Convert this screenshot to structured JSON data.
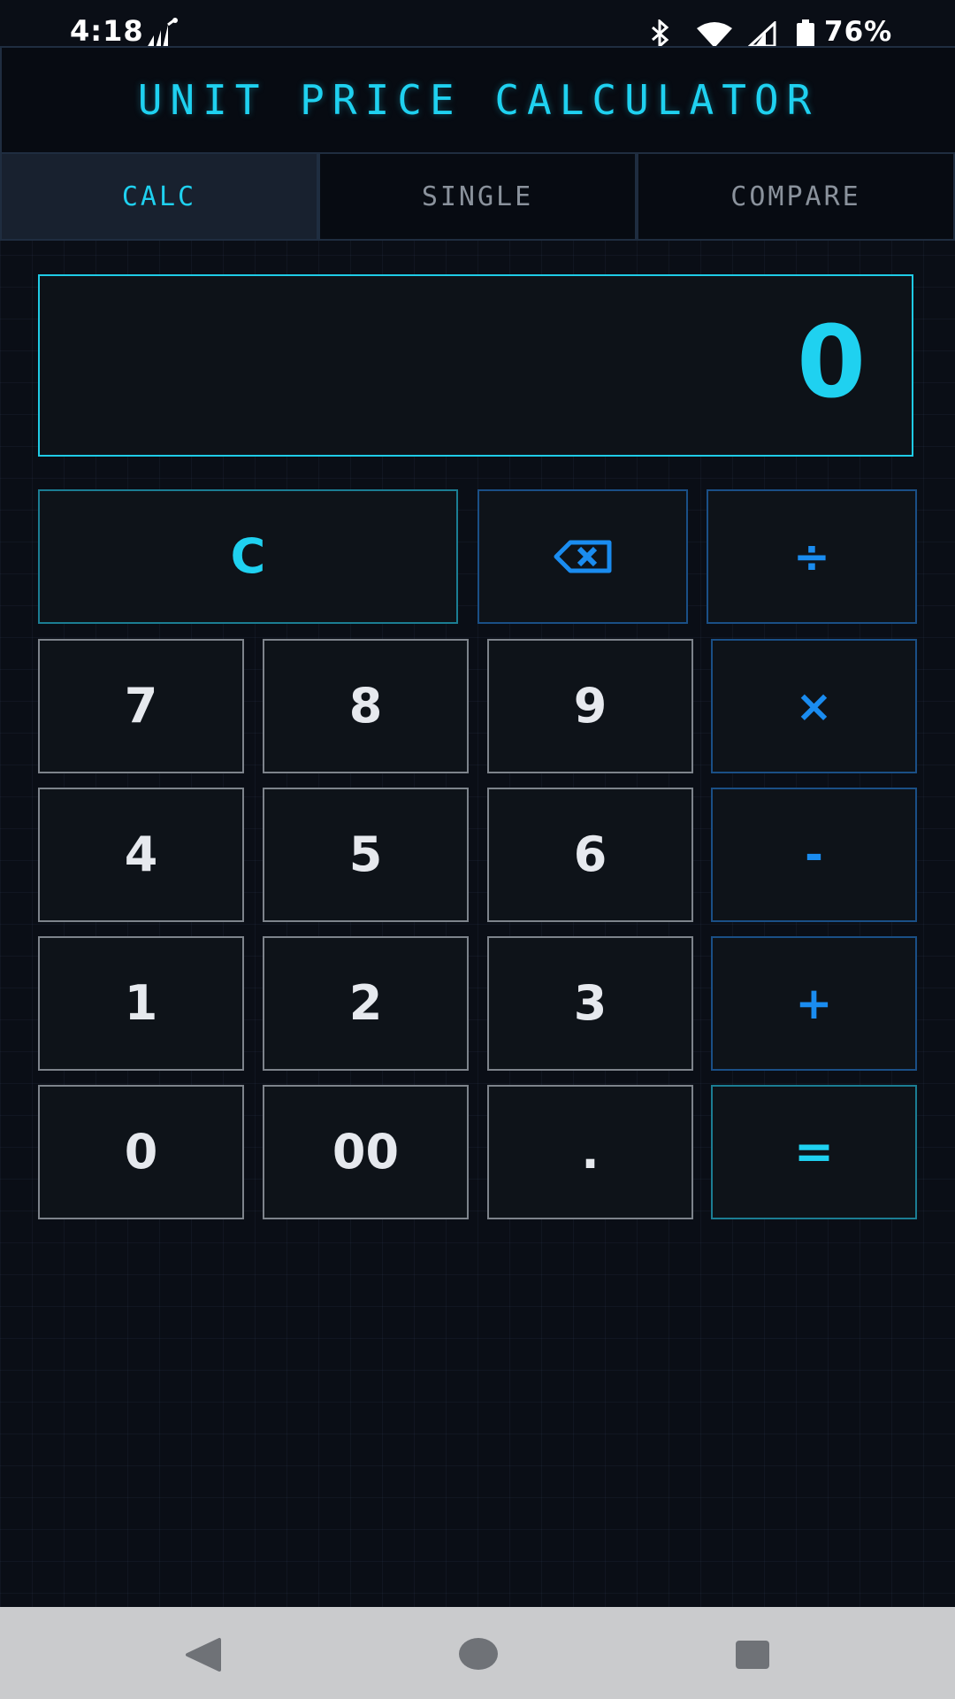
{
  "status_bar": {
    "time": "4:18",
    "battery_percent": "76%",
    "icons": [
      "signal-activity-icon",
      "bluetooth-icon",
      "wifi-icon",
      "cellular-signal-icon",
      "battery-icon"
    ]
  },
  "header": {
    "title": "UNIT PRICE CALCULATOR"
  },
  "tabs": [
    {
      "label": "CALC",
      "active": true
    },
    {
      "label": "SINGLE",
      "active": false
    },
    {
      "label": "COMPARE",
      "active": false
    }
  ],
  "display": {
    "value": "0"
  },
  "keypad": {
    "clear": "C",
    "backspace_icon": "backspace-icon",
    "divide": "÷",
    "multiply": "×",
    "subtract": "-",
    "add": "+",
    "equals": "=",
    "digits": {
      "seven": "7",
      "eight": "8",
      "nine": "9",
      "four": "4",
      "five": "5",
      "six": "6",
      "one": "1",
      "two": "2",
      "three": "3",
      "zero": "0",
      "double_zero": "00",
      "decimal": "."
    }
  },
  "nav_bar": {
    "icons": [
      "back-icon",
      "home-icon",
      "recents-icon"
    ]
  },
  "colors": {
    "accent_cyan": "#1fd1f0",
    "operator_blue": "#1a8cf0",
    "background": "#0a0e16",
    "key_border": "#7d838b",
    "nav_bar": "#cacbcd"
  }
}
